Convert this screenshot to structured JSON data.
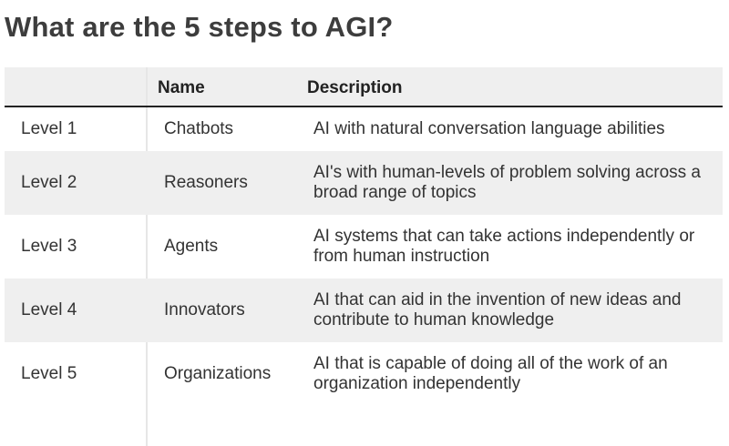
{
  "title": "What are the 5 steps to AGI?",
  "table": {
    "headers": [
      "",
      "Name",
      "Description"
    ],
    "rows": [
      {
        "level": "Level 1",
        "name": "Chatbots",
        "description": "AI with natural conversation language abilities"
      },
      {
        "level": "Level 2",
        "name": "Reasoners",
        "description": "AI's with human-levels of problem solving across a broad range of topics"
      },
      {
        "level": "Level 3",
        "name": "Agents",
        "description": "AI systems that can take actions independently or from human instruction"
      },
      {
        "level": "Level 4",
        "name": "Innovators",
        "description": "AI that can aid in the invention of new ideas and contribute to human knowledge"
      },
      {
        "level": "Level 5",
        "name": "Organizations",
        "description": "AI that is capable of doing all of the work of an organization independently"
      }
    ]
  }
}
